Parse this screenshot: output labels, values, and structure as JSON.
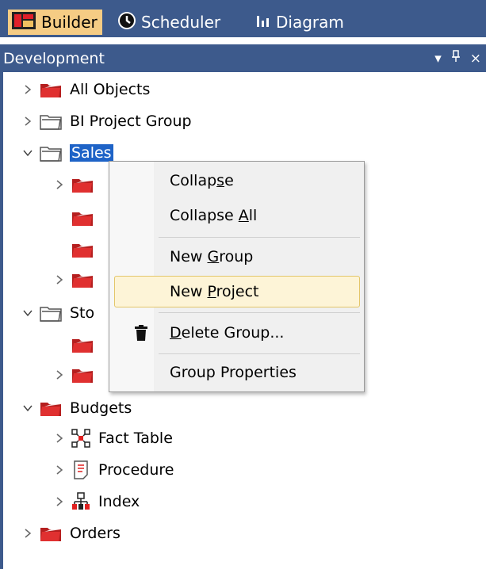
{
  "tabs": [
    {
      "label": "Builder",
      "icon": "builder-icon",
      "active": true
    },
    {
      "label": "Scheduler",
      "icon": "clock-icon",
      "active": false
    },
    {
      "label": "Diagram",
      "icon": "bar-chart-icon",
      "active": false
    }
  ],
  "panel": {
    "title": "Development",
    "controls": [
      "▾",
      "ᵖ",
      "×"
    ]
  },
  "tree": {
    "nodes": [
      {
        "label": "All Objects"
      },
      {
        "label": "BI Project Group"
      },
      {
        "label": "Sales",
        "selected": true
      },
      {
        "label": "Sto"
      },
      {
        "label": "Budgets"
      },
      {
        "label": "Fact Table"
      },
      {
        "label": "Procedure"
      },
      {
        "label": "Index"
      },
      {
        "label": "Orders"
      }
    ]
  },
  "context_menu": {
    "items": [
      {
        "pre": "Collap",
        "u": "s",
        "post": "e"
      },
      {
        "pre": "Collapse ",
        "u": "A",
        "post": "ll"
      },
      {
        "pre": "New ",
        "u": "G",
        "post": "roup"
      },
      {
        "pre": "New ",
        "u": "P",
        "post": "roject",
        "highlighted": true
      },
      {
        "pre": "",
        "u": "D",
        "post": "elete Group...",
        "icon": "trash-icon"
      },
      {
        "pre": "Group Properties",
        "u": "",
        "post": ""
      }
    ]
  },
  "colors": {
    "accent": "#3d5a8c",
    "active_tab": "#f5cc84",
    "selection": "#1e63c7",
    "menu_hover": "#fdf4d7"
  }
}
